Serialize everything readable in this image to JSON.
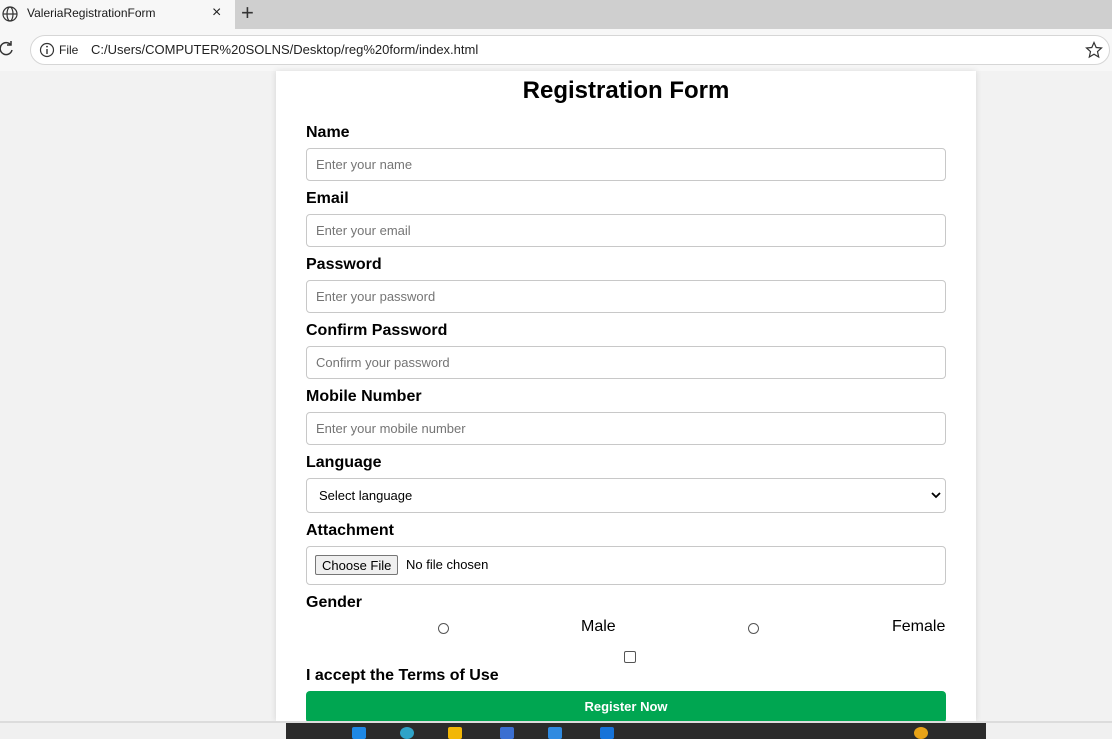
{
  "browser": {
    "tab_title": "ValeriaRegistrationForm",
    "close_symbol": "×",
    "new_tab_symbol": "+",
    "file_label": "File",
    "url": "C:/Users/COMPUTER%20SOLNS/Desktop/reg%20form/index.html"
  },
  "form": {
    "title": "Registration Form",
    "name_label": "Name",
    "name_placeholder": "Enter your name",
    "email_label": "Email",
    "email_placeholder": "Enter your email",
    "password_label": "Password",
    "password_placeholder": "Enter your password",
    "confirm_label": "Confirm Password",
    "confirm_placeholder": "Confirm your password",
    "mobile_label": "Mobile Number",
    "mobile_placeholder": "Enter your mobile number",
    "language_label": "Language",
    "language_selected": "Select language",
    "attachment_label": "Attachment",
    "choose_file": "Choose File",
    "no_file": "No file chosen",
    "gender_label": "Gender",
    "gender_male": "Male",
    "gender_female": "Female",
    "terms_label": "I accept the Terms of Use",
    "register_button": "Register Now"
  },
  "colors": {
    "register_bg": "#00a651",
    "page_bg": "#f2f2f2"
  },
  "icons": {
    "tab": "globe-icon",
    "reload": "reload-icon",
    "info": "info-icon",
    "bookmark": "star-icon",
    "select": "chevron-down-icon"
  }
}
